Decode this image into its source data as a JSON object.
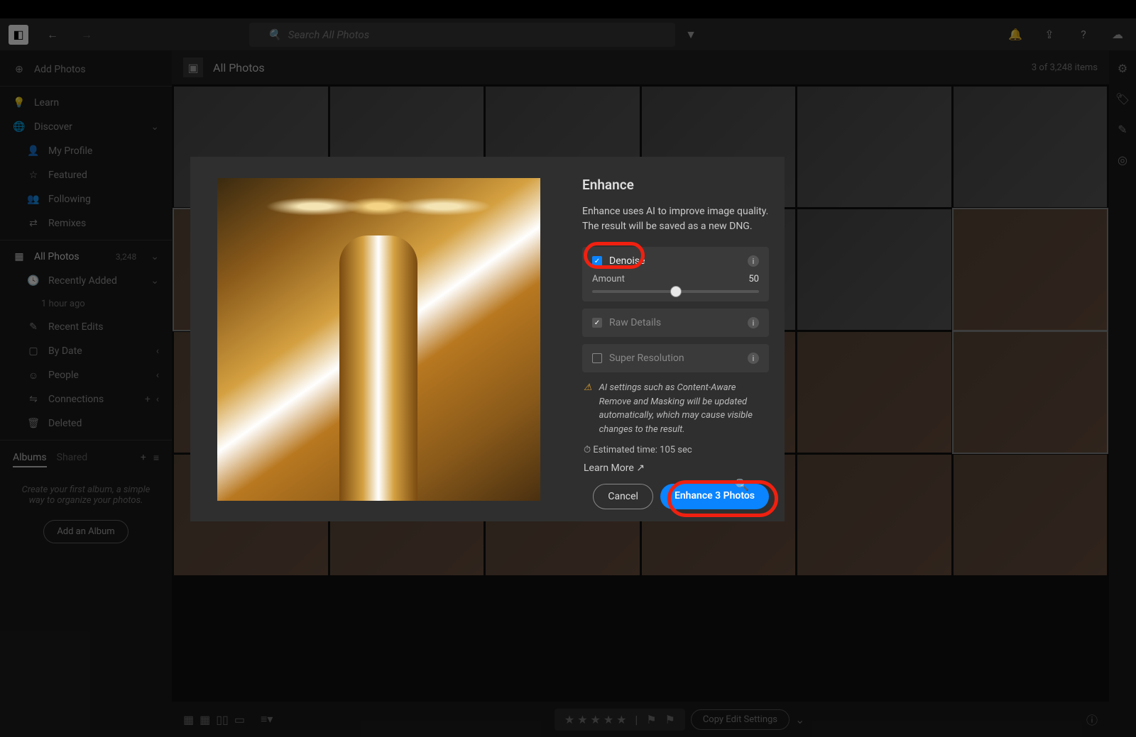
{
  "topbar": {
    "search_placeholder": "Search All Photos"
  },
  "sidebar": {
    "add_photos": "Add Photos",
    "learn": "Learn",
    "discover": "Discover",
    "my_profile": "My Profile",
    "featured": "Featured",
    "following": "Following",
    "remixes": "Remixes",
    "all_photos": "All Photos",
    "all_photos_count": "3,248",
    "recently_added": "Recently Added",
    "recently_time": "1 hour ago",
    "recent_edits": "Recent Edits",
    "by_date": "By Date",
    "people": "People",
    "connections": "Connections",
    "deleted": "Deleted",
    "albums_tab": "Albums",
    "shared_tab": "Shared",
    "album_help": "Create your first album, a simple way to organize your photos.",
    "add_album": "Add an Album"
  },
  "header": {
    "title": "All Photos",
    "status": "3 of 3,248 items"
  },
  "bbar": {
    "copy": "Copy Edit Settings"
  },
  "modal": {
    "title": "Enhance",
    "desc": "Enhance uses AI to improve image quality. The result will be saved as a new DNG.",
    "denoise": "Denoise",
    "amount": "Amount",
    "amount_val": "50",
    "raw_details": "Raw Details",
    "super_res": "Super Resolution",
    "warning": "AI settings such as Content-Aware Remove and Masking will be updated automatically, which may cause visible changes to the result.",
    "time": "Estimated time: 105 sec",
    "learn_more": "Learn More",
    "cancel": "Cancel",
    "enhance_btn": "Enhance 3 Photos"
  }
}
